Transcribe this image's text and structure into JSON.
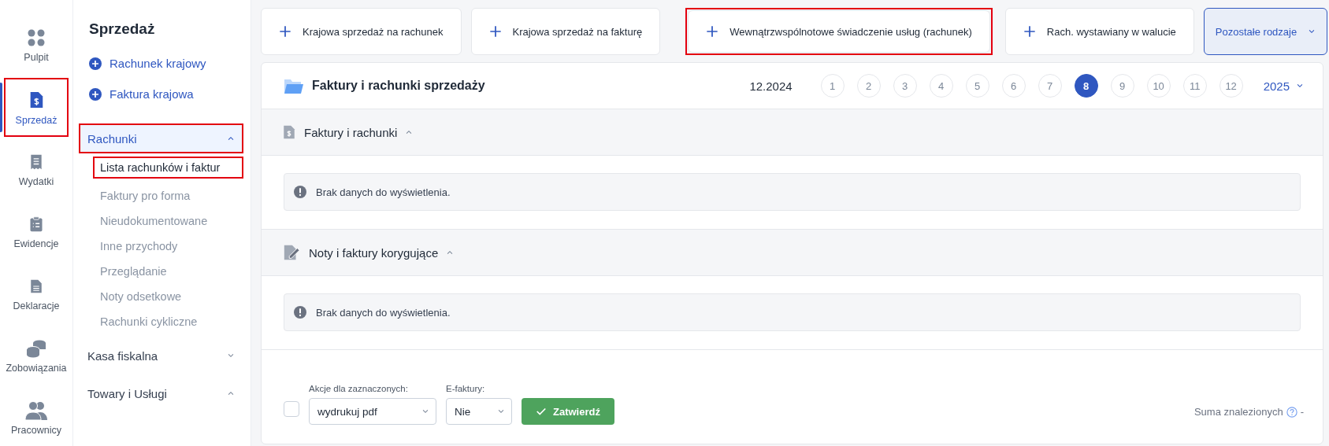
{
  "rail": [
    {
      "label": "Pulpit",
      "kind": "dashboard",
      "selected": false,
      "highlighted": false
    },
    {
      "label": "Sprzedaż",
      "kind": "invoice",
      "selected": true,
      "highlighted": true
    },
    {
      "label": "Wydatki",
      "kind": "receipt",
      "selected": false,
      "highlighted": false
    },
    {
      "label": "Ewidencje",
      "kind": "clipboard",
      "selected": false,
      "highlighted": false
    },
    {
      "label": "Deklaracje",
      "kind": "document",
      "selected": false,
      "highlighted": false
    },
    {
      "label": "Zobowiązania",
      "kind": "coins",
      "selected": false,
      "highlighted": false
    },
    {
      "label": "Pracownicy",
      "kind": "people",
      "selected": false,
      "highlighted": false
    }
  ],
  "submenu": {
    "title": "Sprzedaż",
    "quick_actions": [
      "Rachunek krajowy",
      "Faktura krajowa"
    ],
    "groups": [
      {
        "label": "Rachunki",
        "expanded": true,
        "selected": true,
        "highlighted": true,
        "children": [
          {
            "label": "Lista rachunków i faktur",
            "selected": true,
            "highlighted": true
          },
          {
            "label": "Faktury pro forma",
            "selected": false,
            "highlighted": false
          },
          {
            "label": "Nieudokumentowane",
            "selected": false,
            "highlighted": false
          },
          {
            "label": "Inne przychody",
            "selected": false,
            "highlighted": false
          },
          {
            "label": "Przeglądanie",
            "selected": false,
            "highlighted": false
          },
          {
            "label": "Noty odsetkowe",
            "selected": false,
            "highlighted": false
          },
          {
            "label": "Rachunki cykliczne",
            "selected": false,
            "highlighted": false
          }
        ]
      },
      {
        "label": "Kasa fiskalna",
        "expanded": false,
        "selected": false,
        "highlighted": false
      },
      {
        "label": "Towary i Usługi",
        "expanded": true,
        "selected": false,
        "highlighted": false
      }
    ]
  },
  "top_actions": [
    {
      "label": "Krajowa sprzedaż na rachunek",
      "kind": "add",
      "highlighted": false
    },
    {
      "label": "Krajowa sprzedaż na fakturę",
      "kind": "add",
      "highlighted": false
    },
    {
      "label": "Wewnątrzwspólnotowe świadczenie usług (rachunek)",
      "kind": "add",
      "highlighted": true
    },
    {
      "label": "Rach. wystawiany w walucie",
      "kind": "add",
      "highlighted": false
    },
    {
      "label": "Pozostałe rodzaje",
      "kind": "dropdown"
    }
  ],
  "card": {
    "title": "Faktury i rachunki sprzedaży",
    "period": "12.2024",
    "months": [
      {
        "label": "1",
        "selected": false
      },
      {
        "label": "2",
        "selected": false
      },
      {
        "label": "3",
        "selected": false
      },
      {
        "label": "4",
        "selected": false
      },
      {
        "label": "5",
        "selected": false
      },
      {
        "label": "6",
        "selected": false
      },
      {
        "label": "7",
        "selected": false
      },
      {
        "label": "8",
        "selected": true
      },
      {
        "label": "9",
        "selected": false
      },
      {
        "label": "10",
        "selected": false
      },
      {
        "label": "11",
        "selected": false
      },
      {
        "label": "12",
        "selected": false
      }
    ],
    "year": "2025",
    "sections": [
      {
        "title": "Faktury i rachunki",
        "kind": "invoice",
        "expanded": true,
        "message": "Brak danych do wyświetlenia."
      },
      {
        "title": "Noty i faktury korygujące",
        "kind": "edit",
        "expanded": true,
        "message": "Brak danych do wyświetlenia."
      }
    ],
    "footer": {
      "select_all_checked": false,
      "actions_label": "Akcje dla zaznaczonych:",
      "actions_value": "wydrukuj pdf",
      "efaktury_label": "E-faktury:",
      "efaktury_value": "Nie",
      "confirm": "Zatwierdź",
      "sum_label": "Suma znalezionych",
      "sum_value": "-"
    }
  }
}
